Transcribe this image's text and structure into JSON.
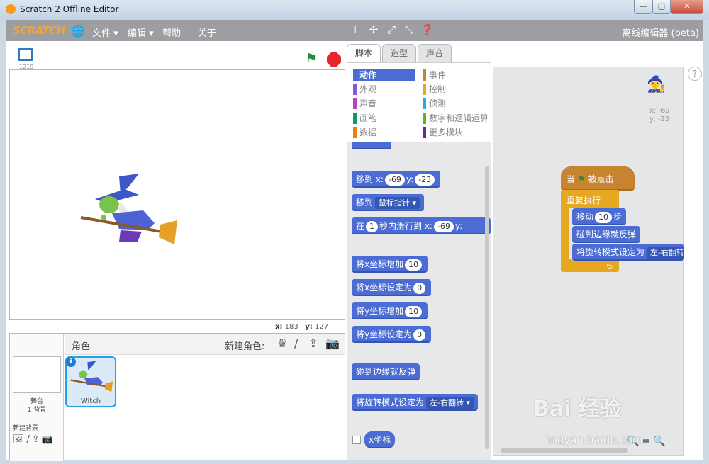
{
  "window": {
    "title": "Scratch 2 Offline Editor",
    "min": "—",
    "max": "▢",
    "close": "✕"
  },
  "menu": {
    "logo": "SCRATCH",
    "file": "文件 ▾",
    "edit": "编辑 ▾",
    "help": "帮助",
    "about": "关于",
    "version": "离线编辑器 (beta)"
  },
  "toolbar_icons": [
    "copy-stamp-icon",
    "cut-icon",
    "grow-icon",
    "shrink-icon",
    "help-block-icon"
  ],
  "stage": {
    "fullscreen_num": "1219",
    "coords": {
      "x_label": "x:",
      "x": "183",
      "y_label": "y:",
      "y": "127"
    }
  },
  "sprites_panel": {
    "title": "角色",
    "new_sprite": "新建角色:",
    "stage_label": "舞台",
    "stage_bg_count": "1 背景",
    "new_backdrop": "新建背景",
    "sprite_name": "Witch"
  },
  "tabs": [
    "脚本",
    "造型",
    "声音"
  ],
  "categories": [
    {
      "name": "动作",
      "color": "#4a6cd4",
      "selected": true
    },
    {
      "name": "事件",
      "color": "#c88330"
    },
    {
      "name": "外观",
      "color": "#8a55d7"
    },
    {
      "name": "控制",
      "color": "#e6a820"
    },
    {
      "name": "声音",
      "color": "#bb42c3"
    },
    {
      "name": "侦测",
      "color": "#2ca5e2"
    },
    {
      "name": "画笔",
      "color": "#0e9a6c"
    },
    {
      "name": "数字和逻辑运算",
      "color": "#5cb712"
    },
    {
      "name": "数据",
      "color": "#ee7d16"
    },
    {
      "name": "更多模块",
      "color": "#632d99"
    }
  ],
  "palette_blocks": {
    "goto_xy": {
      "pre": "移到 x:",
      "x": "-69",
      "mid": "y:",
      "y": "-23"
    },
    "goto_dd": {
      "pre": "移到",
      "opt": "鼠标指针"
    },
    "glide": {
      "pre": "在",
      "secs": "1",
      "mid": "秒内滑行到 x:",
      "x": "-69",
      "y_lbl": "y:"
    },
    "change_x": {
      "pre": "将x坐标增加",
      "val": "10"
    },
    "set_x": {
      "pre": "将x坐标设定为",
      "val": "0"
    },
    "change_y": {
      "pre": "将y坐标增加",
      "val": "10"
    },
    "set_y": {
      "pre": "将y坐标设定为",
      "val": "0"
    },
    "bounce": "碰到边缘就反弹",
    "rotation": {
      "pre": "将旋转模式设定为",
      "opt": "左-右翻转"
    },
    "xpos": "x坐标"
  },
  "script": {
    "hat": {
      "pre": "当",
      "post": "被点击"
    },
    "forever": "重复执行",
    "move": {
      "pre": "移动",
      "val": "10",
      "post": "步"
    },
    "bounce": "碰到边缘就反弹",
    "rotation": {
      "pre": "将旋转模式设定为",
      "opt": "左-右翻转"
    },
    "sprite_xy": {
      "x": "x: -69",
      "y": "y: -23"
    }
  },
  "watermark": {
    "brand": "Bai 经验",
    "url": "jingyan.baidu.com"
  }
}
